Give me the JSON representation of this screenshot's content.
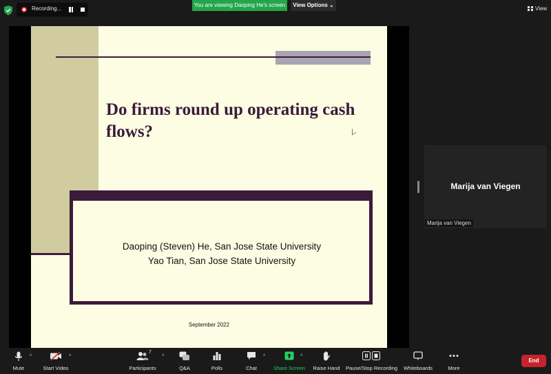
{
  "topbar": {
    "recording_label": "Recording...",
    "viewing_label": "You are viewing Daoping He's screen",
    "view_options_label": "View Options",
    "view_label": "View"
  },
  "slide": {
    "title": "Do firms round up operating cash flows?",
    "authors": [
      "Daoping (Steven) He, San Jose State University",
      "Yao Tian, San Jose State University"
    ],
    "date": "September 2022"
  },
  "participant": {
    "name": "Marija van Viegen",
    "label": "Marija van Viegen"
  },
  "toolbar": {
    "mute": "Mute",
    "start_video": "Start Video",
    "participants": "Participants",
    "participants_count": "7",
    "qa": "Q&A",
    "polls": "Polls",
    "chat": "Chat",
    "share_screen": "Share Screen",
    "raise_hand": "Raise Hand",
    "pause_stop_recording": "Pause/Stop Recording",
    "whiteboards": "Whiteboards",
    "more": "More",
    "end": "End"
  },
  "colors": {
    "accent_green": "#23a54a",
    "end_red": "#c8232c",
    "slide_purple": "#3b1a3a",
    "slide_cream": "#fdfde3",
    "slide_tan": "#d1cc9f"
  }
}
